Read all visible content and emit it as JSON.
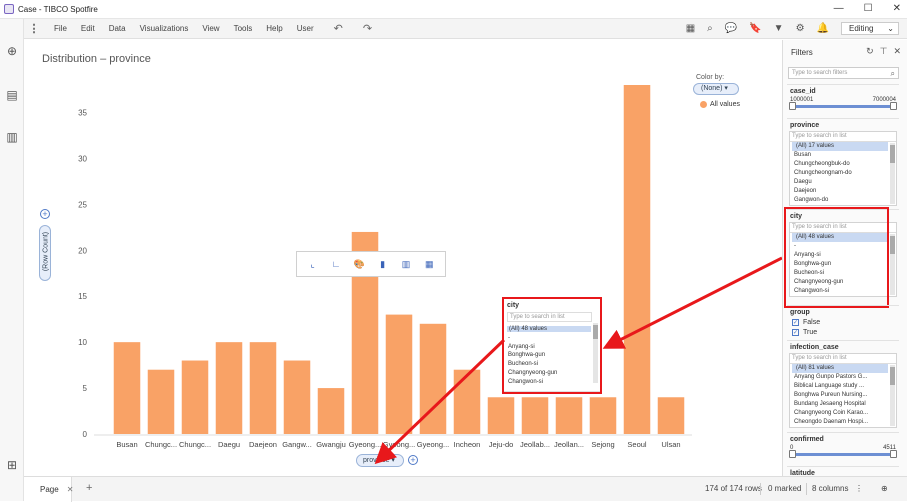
{
  "window": {
    "title": "Case - TIBCO Spotfire",
    "minimize": "—",
    "maximize": "☐",
    "close": "✕"
  },
  "menu": {
    "items": [
      "File",
      "Edit",
      "Data",
      "Visualizations",
      "View",
      "Tools",
      "Help",
      "User"
    ],
    "editing_label": "Editing"
  },
  "viz": {
    "title": "Distribution – province",
    "color_by_label": "Color by:",
    "color_by_value": "(None)",
    "legend_label": "All values",
    "y_axis_label": "(Row Count)",
    "x_axis_label": "province"
  },
  "chart_data": {
    "type": "bar",
    "categories": [
      "Busan",
      "Chungc...",
      "Chungc...",
      "Daegu",
      "Daejeon",
      "Gangw...",
      "Gwangju",
      "Gyeong...",
      "Gyeong...",
      "Gyeong...",
      "Incheon",
      "Jeju-do",
      "Jeollab...",
      "Jeollan...",
      "Sejong",
      "Seoul",
      "Ulsan"
    ],
    "values": [
      10,
      7,
      8,
      10,
      10,
      8,
      5,
      22,
      13,
      12,
      7,
      4,
      4,
      4,
      4,
      38,
      4
    ],
    "ylim": [
      0,
      38
    ],
    "yticks": [
      0,
      5,
      10,
      15,
      20,
      25,
      30,
      35
    ],
    "color": "#f9a266",
    "grid": false,
    "legend": "top-right"
  },
  "city_popup": {
    "title": "city",
    "search": "Type to search in list",
    "items": [
      "(All) 48 values",
      "-",
      "Anyang-si",
      "Bonghwa-gun",
      "Bucheon-si",
      "Changnyeong-gun",
      "Changwon-si"
    ]
  },
  "filters": {
    "title": "Filters",
    "search": "Type to search filters",
    "case_id": {
      "label": "case_id",
      "min": "1000001",
      "max": "7000004"
    },
    "province": {
      "label": "province",
      "search": "Type to search in list",
      "items": [
        "(All) 17 values",
        "Busan",
        "Chungcheongbuk-do",
        "Chungcheongnam-do",
        "Daegu",
        "Daejeon",
        "Gangwon-do"
      ]
    },
    "city": {
      "label": "city",
      "search": "Type to search in list",
      "items": [
        "(All) 48 values",
        "-",
        "Anyang-si",
        "Bonghwa-gun",
        "Bucheon-si",
        "Changnyeong-gun",
        "Changwon-si"
      ]
    },
    "group": {
      "label": "group",
      "options": [
        "False",
        "True"
      ]
    },
    "infection_case": {
      "label": "infection_case",
      "search": "Type to search in list",
      "items": [
        "(All) 81 values",
        "Anyang Gunpo Pastors G...",
        "Biblical Language study ...",
        "Bonghwa Pureun Nursing...",
        "Bundang Jesaeng Hospital",
        "Changnyeong Coin Karao...",
        "Cheongdo Daenam Hospi..."
      ]
    },
    "confirmed": {
      "label": "confirmed",
      "min": "0",
      "max": "4511"
    },
    "latitude": {
      "label": "latitude"
    }
  },
  "status": {
    "page_tab": "Page",
    "rows": "174 of 174 rows",
    "marked": "0 marked",
    "columns": "8 columns"
  }
}
